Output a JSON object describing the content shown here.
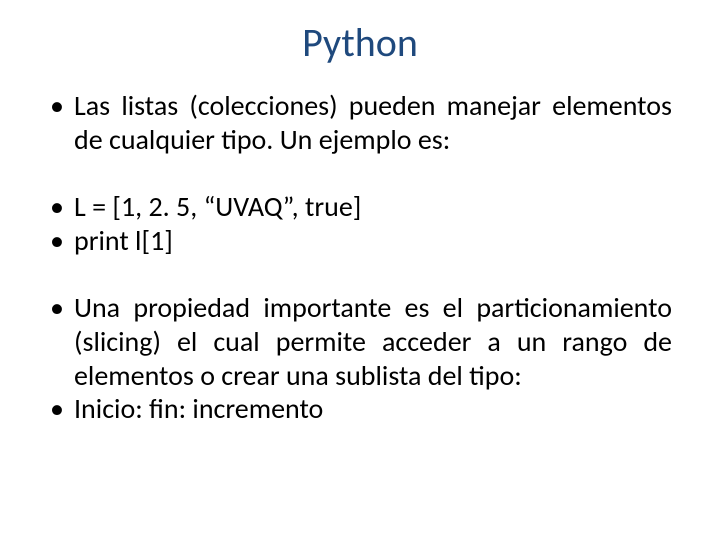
{
  "title": "Python",
  "bullets": {
    "b1": "Las listas (colecciones) pueden manejar elementos de cualquier tipo. Un ejemplo es:",
    "b2": "L = [1, 2. 5, “UVAQ”, true]",
    "b3": "print l[1]",
    "b4": "Una propiedad importante es el particionamiento (slicing) el cual permite acceder a un rango de elementos o crear una sublista del tipo:",
    "b5": "Inicio: fin: incremento"
  }
}
